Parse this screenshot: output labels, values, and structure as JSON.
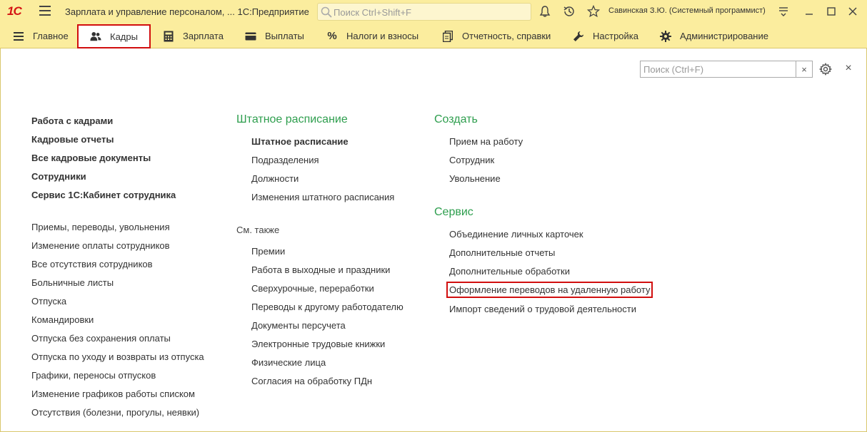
{
  "titlebar": {
    "logo": "1С",
    "title": "Зарплата и управление персоналом, ...  1С:Предприятие",
    "search_placeholder": "Поиск Ctrl+Shift+F",
    "user": "Савинская З.Ю. (Системный программист)",
    "icons": [
      "bell-icon",
      "history-icon",
      "star-icon",
      "menu-lines-icon",
      "minimize-icon",
      "maximize-icon",
      "close-icon"
    ]
  },
  "menubar": {
    "items": [
      {
        "label": "Главное",
        "icon": "hamburger-icon"
      },
      {
        "label": "Кадры",
        "icon": "people-icon",
        "active": true
      },
      {
        "label": "Зарплата",
        "icon": "calculator-icon"
      },
      {
        "label": "Выплаты",
        "icon": "wallet-icon"
      },
      {
        "label": "Налоги и взносы",
        "icon": "percent-icon"
      },
      {
        "label": "Отчетность, справки",
        "icon": "documents-icon"
      },
      {
        "label": "Настройка",
        "icon": "wrench-icon"
      },
      {
        "label": "Администрирование",
        "icon": "gear-icon"
      }
    ]
  },
  "panel": {
    "search_placeholder": "Поиск (Ctrl+F)",
    "clear": "×",
    "close": "×"
  },
  "col1": {
    "main": [
      "Работа с кадрами",
      "Кадровые отчеты",
      "Все кадровые документы",
      "Сотрудники",
      "Сервис 1С:Кабинет сотрудника"
    ],
    "items": [
      "Приемы, переводы, увольнения",
      "Изменение оплаты сотрудников",
      "Все отсутствия сотрудников",
      "Больничные листы",
      "Отпуска",
      "Командировки",
      "Отпуска без сохранения оплаты",
      "Отпуска по уходу и возвраты из отпуска",
      "Графики, переносы отпусков",
      "Изменение графиков работы списком",
      "Отсутствия (болезни, прогулы, неявки)"
    ]
  },
  "col2": {
    "heading": "Штатное расписание",
    "items": [
      "Штатное расписание",
      "Подразделения",
      "Должности",
      "Изменения штатного расписания"
    ],
    "see_also": "См. также",
    "see_items": [
      "Премии",
      "Работа в выходные и праздники",
      "Сверхурочные, переработки",
      "Переводы к другому работодателю",
      "Документы персучета",
      "Электронные трудовые книжки",
      "Физические лица",
      "Согласия на обработку ПДн"
    ]
  },
  "col3": {
    "create_heading": "Создать",
    "create_items": [
      "Прием на работу",
      "Сотрудник",
      "Увольнение"
    ],
    "service_heading": "Сервис",
    "service_items": [
      "Объединение личных карточек",
      "Дополнительные отчеты",
      "Дополнительные обработки",
      "Оформление переводов на удаленную работу",
      "Импорт сведений о трудовой деятельности"
    ]
  }
}
